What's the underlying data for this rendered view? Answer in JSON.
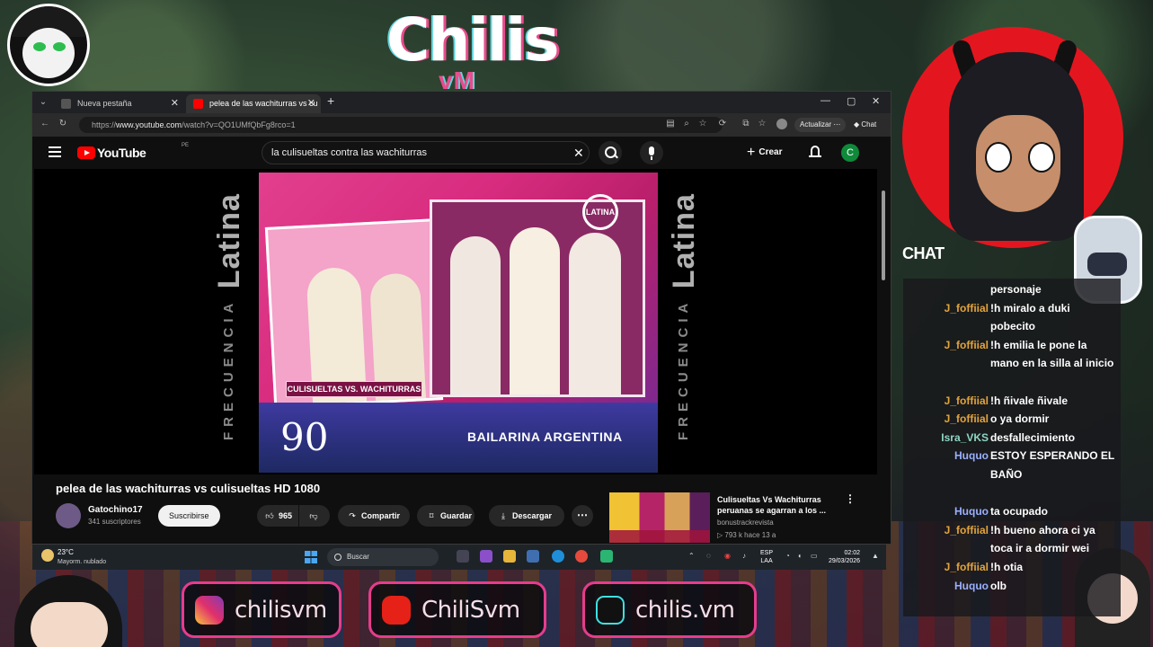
{
  "stream": {
    "brand": {
      "logo_main": "Chilis",
      "logo_sub": "vM"
    },
    "chat_label": "CHAT",
    "socials": [
      {
        "icon": "instagram-icon",
        "handle": "chilisvm"
      },
      {
        "icon": "youtube-icon",
        "handle": "ChiliSvm"
      },
      {
        "icon": "tiktok-icon",
        "handle": "chilis.vm"
      }
    ]
  },
  "browser": {
    "tabs": [
      {
        "label": "Nueva pestaña",
        "active": false
      },
      {
        "label": "pelea de las wachiturras vs cu",
        "active": true
      }
    ],
    "url_prefix": "https://",
    "url_host": "www.youtube.com",
    "url_path": "/watch?v=QO1UMfQbFg8rco=1",
    "update_label": "Actualizar",
    "chat_button_label": "Chat"
  },
  "youtube": {
    "logo_text": "YouTube",
    "country_code": "PE",
    "search_query": "la culisueltas contra las wachiturras",
    "create_label": "Crear",
    "account_initial": "C",
    "video": {
      "title": "pelea de las wachiturras vs culisueltas HD 1080",
      "side_text_top": "FRECUENCIA",
      "side_brand": "Latina",
      "caption": "CULISUELTAS VS. WACHITURRAS",
      "counter": "90",
      "lower_third": "BAILARINA ARGENTINA",
      "corner_logo": "LATINA"
    },
    "channel": {
      "name": "Gatochino17",
      "subscribers": "341 suscriptores",
      "subscribe_label": "Suscribirse"
    },
    "actions": {
      "likes": "965",
      "share_label": "Compartir",
      "save_label": "Guardar",
      "download_label": "Descargar"
    },
    "recommended": {
      "title": "Culisueltas Vs Wachiturras peruanas se agarran a los ...",
      "channel": "bonustrackrevista",
      "meta": "▷ 793 k  hace 13 a"
    }
  },
  "taskbar": {
    "weather_temp": "23°C",
    "weather_desc": "Mayorm. nublado",
    "search_label": "Buscar",
    "lang_line1": "ESP",
    "lang_line2": "LAA",
    "time": "02:02",
    "date": "29/03/2026"
  },
  "chat": {
    "messages": [
      {
        "user": "",
        "message": "personaje",
        "user_color": "#e3a43b"
      },
      {
        "user": "J_foffiial",
        "message": "!h miralo a duki pobecito",
        "user_color": "#e3a43b"
      },
      {
        "user": "J_foffiial",
        "message": "!h emilia le pone la mano en la silla al inicio",
        "user_color": "#e3a43b"
      },
      {
        "user": "J_foffiial",
        "message": "!h ñivale ñivale",
        "user_color": "#e3a43b"
      },
      {
        "user": "J_foffiial",
        "message": "o ya dormir",
        "user_color": "#e3a43b"
      },
      {
        "user": "Isra_VKS",
        "message": "desfallecimiento",
        "user_color": "#8fd6c3"
      },
      {
        "user": "Huquo",
        "message": "ESTOY ESPERANDO EL BAÑO",
        "user_color": "#9bb0ff"
      },
      {
        "user": "Huquo",
        "message": "ta ocupado",
        "user_color": "#9bb0ff"
      },
      {
        "user": "J_foffiial",
        "message": "!h bueno ahora ci ya toca ir a dormir wei",
        "user_color": "#e3a43b"
      },
      {
        "user": "J_foffiial",
        "message": "!h otia",
        "user_color": "#e3a43b"
      },
      {
        "user": "Huquo",
        "message": "olb",
        "user_color": "#9bb0ff"
      }
    ]
  },
  "colors": {
    "accent_pink": "#e63c8c",
    "youtube_red": "#ff0000",
    "chat_bg": "#19191c"
  }
}
